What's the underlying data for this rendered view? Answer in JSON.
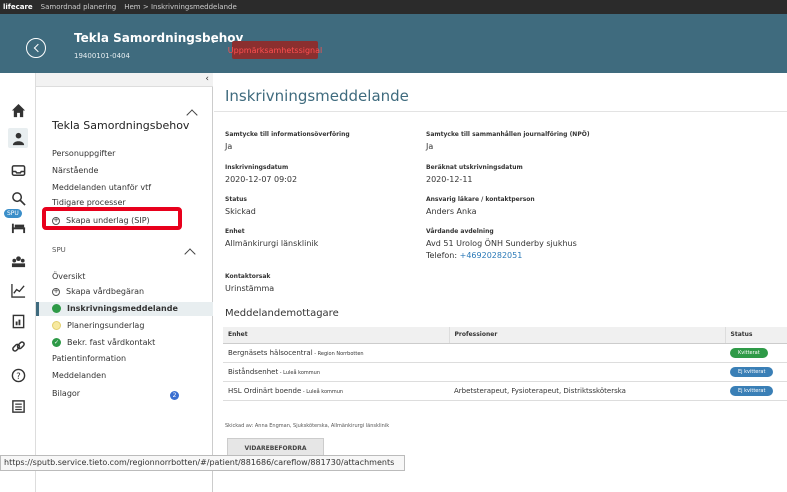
{
  "topbar": {
    "brand": "lifecare",
    "context": "Samordnad planering",
    "breadcrumb": "Hem > Inskrivningsmeddelande"
  },
  "patient": {
    "name": "Tekla Samordningsbehov",
    "id": "19400101-0404",
    "badge": "Uppmärksamhetssignal"
  },
  "iconbar": {
    "spu_badge": "SPU"
  },
  "sidebar": {
    "title": "Tekla Samordningsbehov",
    "items": [
      "Personuppgifter",
      "Närstående",
      "Meddelanden utanför vtf",
      "Tidigare processer"
    ],
    "create_sip": "Skapa underlag (SIP)",
    "section_label": "SPU",
    "overview": "Översikt",
    "create_request": "Skapa vårdbegäran",
    "admission_message": "Inskrivningsmeddelande",
    "planning_basis": "Planeringsunderlag",
    "confirmed_contact": "Bekr. fast vårdkontakt",
    "patient_info": "Patientinformation",
    "messages": "Meddelanden",
    "attachments": "Bilagor",
    "attachments_count": "2"
  },
  "main": {
    "title": "Inskrivningsmeddelande",
    "fields": {
      "consent_info_label": "Samtycke till informationsöverföring",
      "consent_info": "Ja",
      "consent_npo_label": "Samtycke till sammanhållen journalföring (NPÖ)",
      "consent_npo": "Ja",
      "admission_date_label": "Inskrivningsdatum",
      "admission_date": "2020-12-07 09:02",
      "discharge_date_label": "Beräknat utskrivningsdatum",
      "discharge_date": "2020-12-11",
      "status_label": "Status",
      "status": "Skickad",
      "physician_label": "Ansvarig läkare / kontaktperson",
      "physician": "Anders Anka",
      "unit_label": "Enhet",
      "unit": "Allmänkirurgi länsklinik",
      "ward_label": "Vårdande avdelning",
      "ward": "Avd 51 Urolog ÖNH Sunderby sjukhus",
      "phone_prefix": "Telefon: ",
      "phone": "+46920282051",
      "contact_reason_label": "Kontaktorsak",
      "contact_reason": "Urinstämma"
    },
    "recipients_title": "Meddelandemottagare",
    "table": {
      "headers": [
        "Enhet",
        "Professioner",
        "Status"
      ],
      "rows": [
        {
          "unit": "Bergnäsets hälsocentral",
          "org": " - Region Norrbotten",
          "professions": "",
          "status": "Kvitterat",
          "status_color": "#2e9a47"
        },
        {
          "unit": "Biståndsenhet",
          "org": " - Luleå kommun",
          "professions": "",
          "status": "Ej kvitterat",
          "status_color": "#3a7fb6"
        },
        {
          "unit": "HSL Ordinärt boende",
          "org": " - Luleå kommun",
          "professions": "Arbetsterapeut, Fysioterapeut, Distriktssköterska",
          "status": "Ej kvitterat",
          "status_color": "#3a7fb6"
        }
      ]
    },
    "sent_by": "Skickad av: Anna Engman, Sjuksköterska, Allmänkirurgi länsklinik",
    "forward_button": "VIDAREBEFORDRA"
  },
  "status_url": "https://sputb.service.tieto.com/regionnorrbotten/#/patient/881686/careflow/881730/attachments"
}
